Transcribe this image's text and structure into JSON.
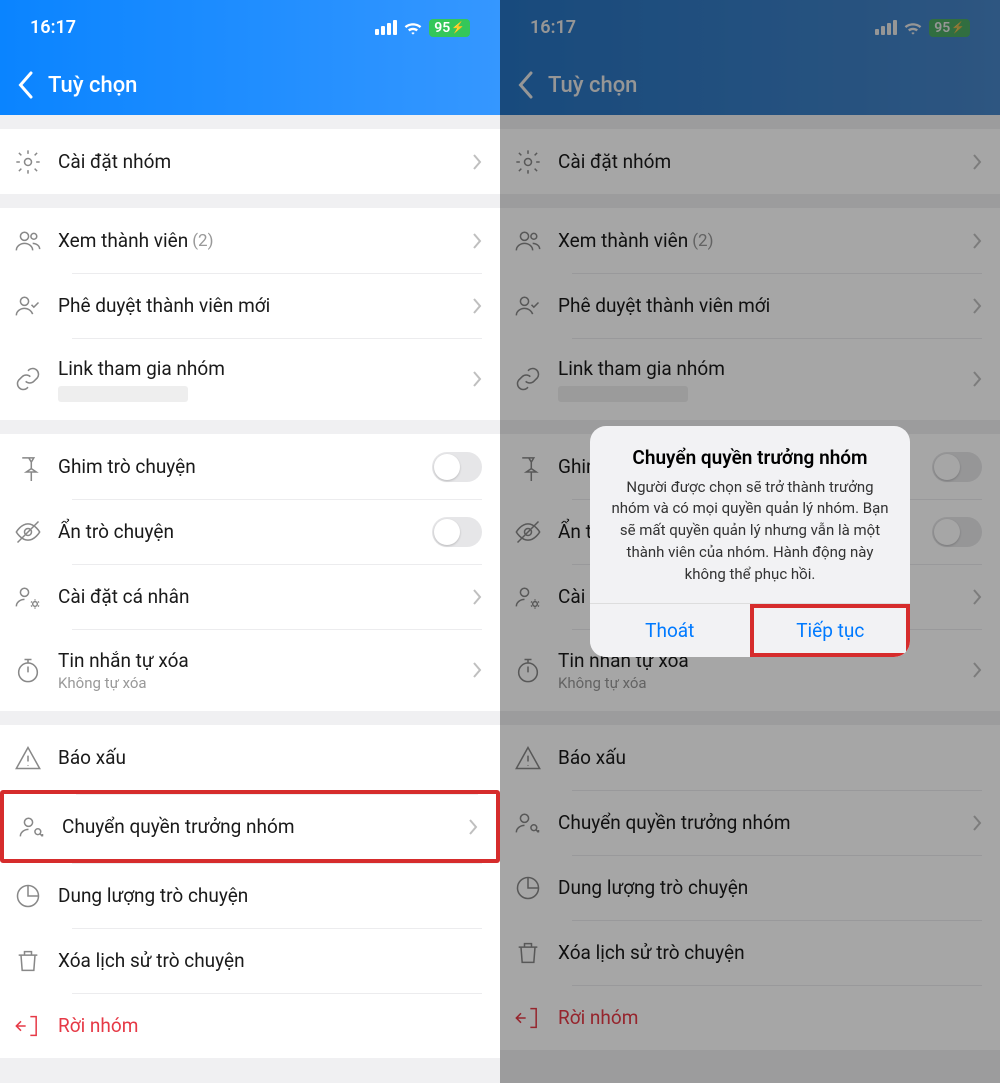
{
  "status": {
    "time": "16:17",
    "battery": "95"
  },
  "header": {
    "title": "Tuỳ chọn"
  },
  "rows": {
    "settings": {
      "label": "Cài đặt nhóm"
    },
    "members": {
      "label": "Xem thành viên",
      "count": "(2)"
    },
    "approve": {
      "label": "Phê duyệt thành viên mới"
    },
    "link": {
      "label": "Link tham gia nhóm"
    },
    "pin": {
      "label": "Ghim trò chuyện"
    },
    "hide": {
      "label": "Ẩn trò chuyện"
    },
    "personal": {
      "label": "Cài đặt cá nhân"
    },
    "autodelete": {
      "label": "Tin nhắn tự xóa",
      "sub": "Không tự xóa"
    },
    "report": {
      "label": "Báo xấu"
    },
    "transfer": {
      "label": "Chuyển quyền trưởng nhóm"
    },
    "storage": {
      "label": "Dung lượng trò chuyện"
    },
    "clear": {
      "label": "Xóa lịch sử trò chuyện"
    },
    "leave": {
      "label": "Rời nhóm"
    }
  },
  "dialog": {
    "title": "Chuyển quyền trưởng nhóm",
    "message": "Người được chọn sẽ trở thành trưởng nhóm và có mọi quyền quản lý nhóm. Bạn sẽ mất quyền quản lý nhưng vẫn là một thành viên của nhóm. Hành động này không thể phục hồi.",
    "cancel": "Thoát",
    "confirm": "Tiếp tục"
  }
}
